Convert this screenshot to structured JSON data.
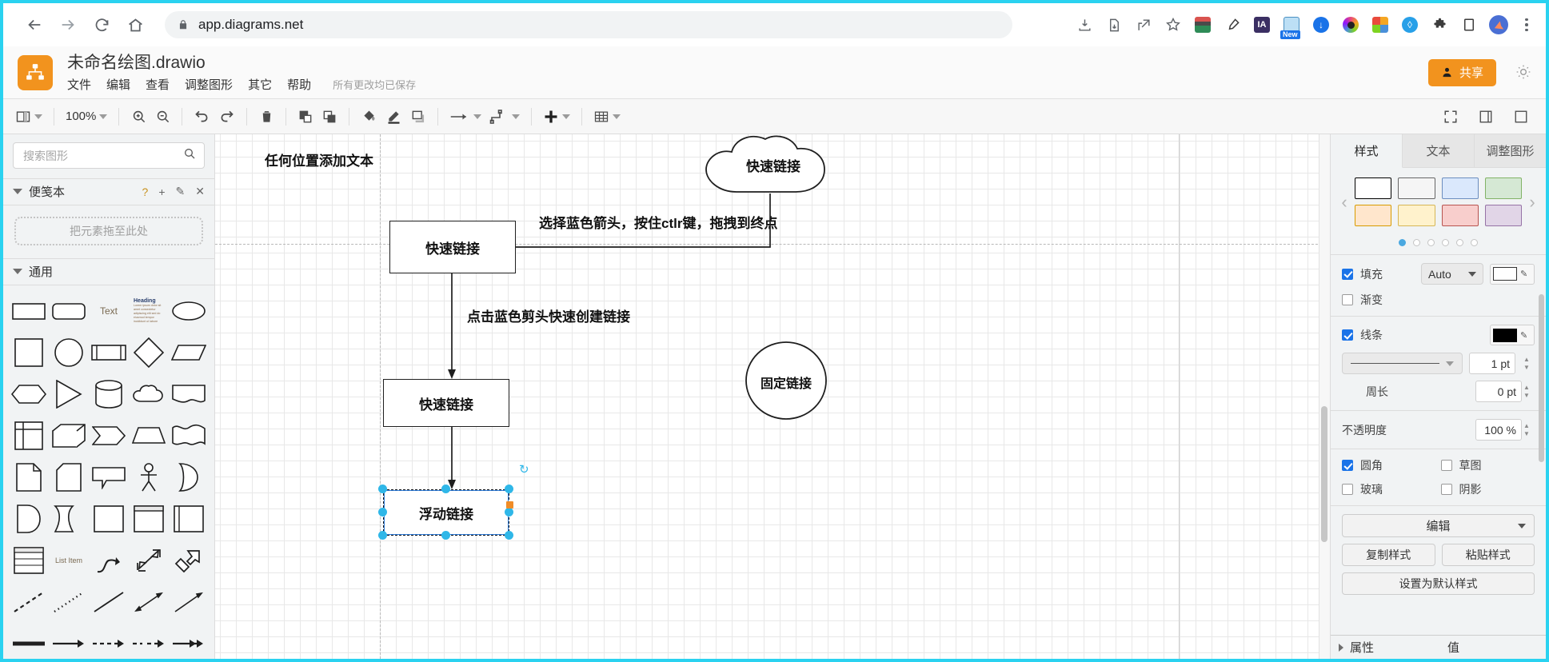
{
  "browser": {
    "url": "app.diagrams.net",
    "nav": [
      "back-arrow",
      "forward-arrow",
      "reload",
      "home"
    ],
    "extensions": [
      "install-page-icon",
      "save-page-icon",
      "share-icon",
      "bookmark-star-icon",
      "calculator-icon",
      "eyedropper-icon",
      "ia-writer-icon",
      "new-tool-icon",
      "download-blue-icon",
      "camera-lens-icon",
      "color-grid-icon",
      "water-drop-icon",
      "puzzle-icon",
      "side-panel-icon",
      "profile-avatar-icon",
      "kebab-menu-icon"
    ],
    "new_badge": "New"
  },
  "app": {
    "title": "未命名绘图.drawio",
    "menus": [
      "文件",
      "编辑",
      "查看",
      "调整图形",
      "其它",
      "帮助"
    ],
    "save_status": "所有更改均已保存",
    "share_label": "共享"
  },
  "toolbar": {
    "zoom_level": "100%",
    "items": [
      "view-layout-icon",
      "zoom-select",
      "zoom-in-icon",
      "zoom-out-icon",
      "undo-icon",
      "redo-icon",
      "delete-icon",
      "to-front-icon",
      "to-back-icon",
      "fill-color-icon",
      "line-color-icon",
      "shadow-icon",
      "connection-arrow-icon",
      "waypoints-icon",
      "insert-icon",
      "table-icon"
    ],
    "right_items": [
      "fullscreen-icon",
      "format-panel-icon",
      "outline-icon"
    ]
  },
  "sidebar": {
    "search_placeholder": "搜索图形",
    "scratchpad": {
      "label": "便笺本",
      "actions": [
        "?",
        "+",
        "✎",
        "✕"
      ],
      "drop_hint": "把元素拖至此处"
    },
    "general": {
      "label": "通用"
    },
    "shapes": [
      "rectangle",
      "rounded-rectangle",
      "text",
      "heading-textblock",
      "ellipse",
      "square",
      "circle",
      "process",
      "diamond",
      "parallelogram",
      "hexagon",
      "triangle",
      "cylinder",
      "cloud",
      "document",
      "internal-storage",
      "cube",
      "step",
      "trapezoid",
      "tape",
      "note",
      "card",
      "callout",
      "actor",
      "or-shape",
      "delay",
      "double-arrow-shape",
      "container",
      "vertical-container",
      "vertical-frame",
      "list-shape",
      "list-item",
      "curve-arrow",
      "bidirectional-arrow",
      "block-arrow",
      "dashed-line",
      "dotted-line",
      "solid-line",
      "bidirectional-line",
      "directional-line",
      "thick-line",
      "directional-connector",
      "dashed-connector",
      "dashed-dir-connector",
      "double-connector"
    ]
  },
  "canvas": {
    "texts": [
      {
        "name": "free-text-label",
        "value": "任何位置添加文本"
      },
      {
        "name": "annotation-ctrl-drag",
        "value": "选择蓝色箭头，按住ctlr键，拖拽到终点"
      },
      {
        "name": "annotation-click-arrow",
        "value": "点击蓝色剪头快速创建链接"
      }
    ],
    "nodes": [
      {
        "name": "node-quick-link-top",
        "label": "快速链接",
        "shape": "rectangle"
      },
      {
        "name": "node-quick-link-mid",
        "label": "快速链接",
        "shape": "rectangle"
      },
      {
        "name": "node-floating-link",
        "label": "浮动链接",
        "shape": "rectangle",
        "selected": true
      },
      {
        "name": "node-cloud-quick-link",
        "label": "快速链接",
        "shape": "cloud"
      },
      {
        "name": "node-fixed-link",
        "label": "固定链接",
        "shape": "ellipse"
      }
    ]
  },
  "right_panel": {
    "tabs": [
      {
        "label": "样式",
        "active": true
      },
      {
        "label": "文本",
        "active": false
      },
      {
        "label": "调整图形",
        "active": false
      }
    ],
    "swatches": [
      {
        "fill": "#ffffff",
        "border": "#000000"
      },
      {
        "fill": "#f5f5f5",
        "border": "#666666"
      },
      {
        "fill": "#dae8fc",
        "border": "#6c8ebf"
      },
      {
        "fill": "#d5e8d4",
        "border": "#82b366"
      },
      {
        "fill": "#ffe6cc",
        "border": "#d79b00"
      },
      {
        "fill": "#fff2cc",
        "border": "#d6b656"
      },
      {
        "fill": "#f8cecc",
        "border": "#b85450"
      },
      {
        "fill": "#e1d5e7",
        "border": "#9673a6"
      }
    ],
    "page_dots": 6,
    "active_dot": 0,
    "fill": {
      "label": "填充",
      "checked": true,
      "mode": "Auto",
      "color": "#ffffff"
    },
    "gradient": {
      "label": "渐变",
      "checked": false
    },
    "line": {
      "label": "线条",
      "checked": true,
      "color": "#000000",
      "width": "1 pt"
    },
    "perimeter": {
      "label": "周长",
      "value": "0 pt"
    },
    "opacity": {
      "label": "不透明度",
      "value": "100 %"
    },
    "toggles": [
      {
        "label": "圆角",
        "checked": true
      },
      {
        "label": "草图",
        "checked": false
      },
      {
        "label": "玻璃",
        "checked": false
      },
      {
        "label": "阴影",
        "checked": false
      }
    ],
    "edit_label": "编辑",
    "copy_style": "复制样式",
    "paste_style": "粘贴样式",
    "set_default": "设置为默认样式",
    "properties_header": "属性",
    "value_header": "值"
  }
}
